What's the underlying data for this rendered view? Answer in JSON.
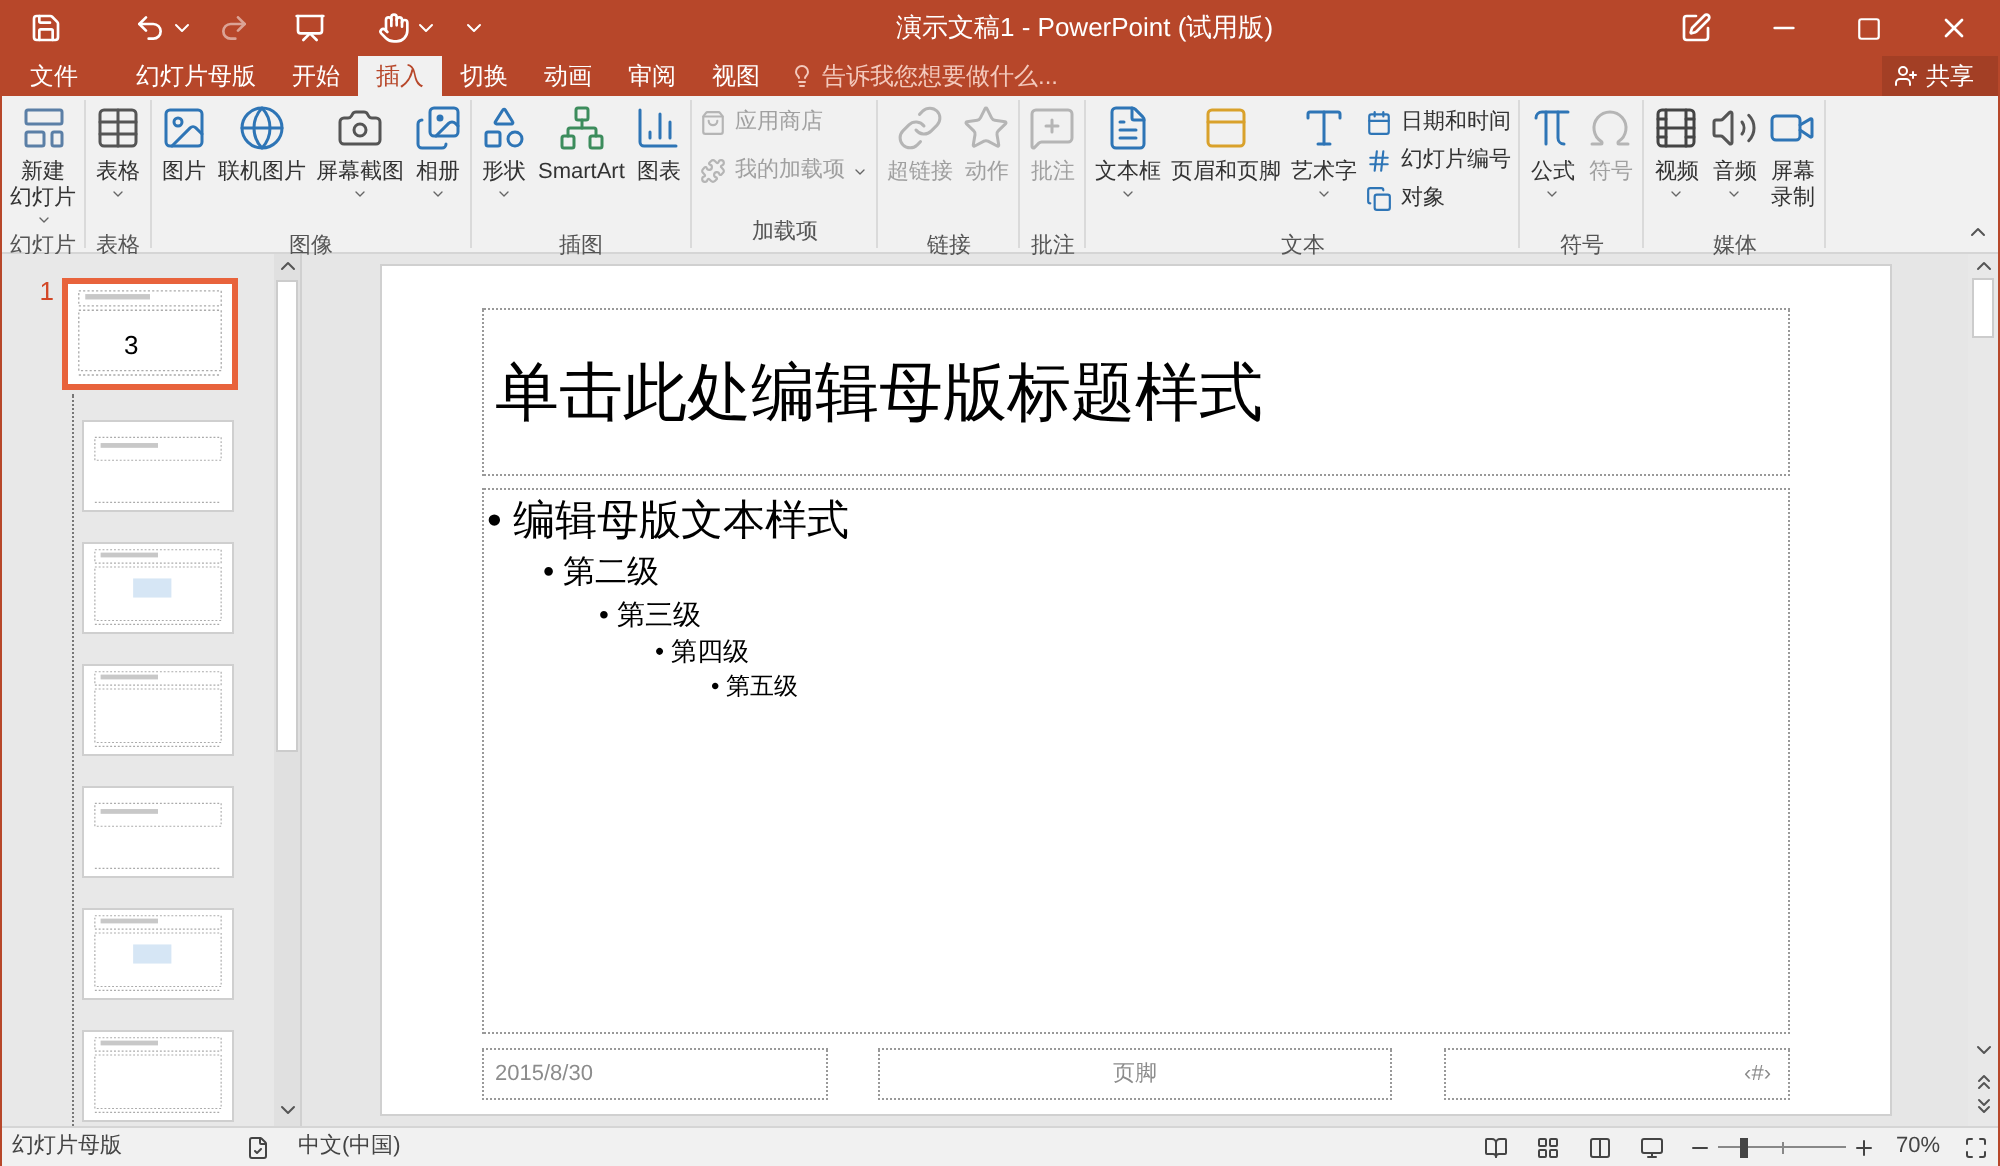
{
  "window": {
    "title": "演示文稿1 - PowerPoint (试用版)"
  },
  "tabs": [
    {
      "label": "文件",
      "selected": false
    },
    {
      "label": "幻灯片母版",
      "selected": false
    },
    {
      "label": "开始",
      "selected": false
    },
    {
      "label": "插入",
      "selected": true
    },
    {
      "label": "切换",
      "selected": false
    },
    {
      "label": "动画",
      "selected": false
    },
    {
      "label": "审阅",
      "selected": false
    },
    {
      "label": "视图",
      "selected": false
    }
  ],
  "tell_me": {
    "placeholder": "告诉我您想要做什么..."
  },
  "share_button": "共享",
  "ribbon_groups": [
    {
      "name": "幻灯片",
      "items": [
        {
          "kind": "large",
          "label": [
            "新建",
            "幻灯片"
          ],
          "dropdown": true,
          "disabled": false
        }
      ]
    },
    {
      "name": "表格",
      "items": [
        {
          "kind": "large",
          "label": "表格",
          "dropdown": true,
          "disabled": false
        }
      ]
    },
    {
      "name": "图像",
      "items": [
        {
          "kind": "large",
          "label": "图片",
          "dropdown": false,
          "disabled": false
        },
        {
          "kind": "large",
          "label": "联机图片",
          "dropdown": false,
          "disabled": false
        },
        {
          "kind": "large",
          "label": "屏幕截图",
          "dropdown": true,
          "disabled": false
        },
        {
          "kind": "large",
          "label": "相册",
          "dropdown": true,
          "disabled": false
        }
      ]
    },
    {
      "name": "插图",
      "items": [
        {
          "kind": "large",
          "label": "形状",
          "dropdown": true,
          "disabled": false
        },
        {
          "kind": "large",
          "label": "SmartArt",
          "dropdown": false,
          "disabled": false
        },
        {
          "kind": "large",
          "label": "图表",
          "dropdown": false,
          "disabled": false
        }
      ]
    },
    {
      "name": "加载项",
      "items": [
        {
          "kind": "small",
          "label": "应用商店",
          "dropdown": false,
          "disabled": true
        },
        {
          "kind": "small",
          "label": "我的加载项",
          "dropdown": true,
          "disabled": true
        }
      ]
    },
    {
      "name": "链接",
      "items": [
        {
          "kind": "large",
          "label": "超链接",
          "dropdown": false,
          "disabled": true
        },
        {
          "kind": "large",
          "label": "动作",
          "dropdown": false,
          "disabled": true
        }
      ]
    },
    {
      "name": "批注",
      "items": [
        {
          "kind": "large",
          "label": "批注",
          "dropdown": false,
          "disabled": true
        }
      ]
    },
    {
      "name": "文本",
      "items": [
        {
          "kind": "large",
          "label": "文本框",
          "dropdown": true,
          "disabled": false
        },
        {
          "kind": "large",
          "label": "页眉和页脚",
          "dropdown": false,
          "disabled": false
        },
        {
          "kind": "large",
          "label": "艺术字",
          "dropdown": true,
          "disabled": false
        },
        {
          "kind": "small",
          "label": "日期和时间",
          "dropdown": false,
          "disabled": false
        },
        {
          "kind": "small",
          "label": "幻灯片编号",
          "dropdown": false,
          "disabled": false
        },
        {
          "kind": "small",
          "label": "对象",
          "dropdown": false,
          "disabled": false
        }
      ]
    },
    {
      "name": "符号",
      "items": [
        {
          "kind": "large",
          "label": "公式",
          "dropdown": true,
          "disabled": false
        },
        {
          "kind": "large",
          "label": "符号",
          "dropdown": false,
          "disabled": true
        }
      ]
    },
    {
      "name": "媒体",
      "items": [
        {
          "kind": "large",
          "label": "视频",
          "dropdown": true,
          "disabled": false
        },
        {
          "kind": "large",
          "label": "音频",
          "dropdown": true,
          "disabled": false
        },
        {
          "kind": "large",
          "label": [
            "屏幕",
            "录制"
          ],
          "dropdown": false,
          "disabled": false
        }
      ]
    }
  ],
  "thumbnails": [
    {
      "index": "1",
      "selected": true,
      "text": "3"
    },
    {
      "selected": false
    },
    {
      "selected": false
    },
    {
      "selected": false
    },
    {
      "selected": false
    },
    {
      "selected": false
    },
    {
      "selected": false
    }
  ],
  "slide": {
    "title": "单击此处编辑母版标题样式",
    "bullets": [
      {
        "bullet": "•",
        "text": "编辑母版文本样式",
        "children": [
          {
            "bullet": "•",
            "text": "第二级",
            "children": [
              {
                "bullet": "•",
                "text": "第三级",
                "children": [
                  {
                    "bullet": "•",
                    "text": "第四级",
                    "children": [
                      {
                        "bullet": "•",
                        "text": "第五级"
                      }
                    ]
                  }
                ]
              }
            ]
          }
        ]
      }
    ],
    "footer": {
      "date": "2015/8/30",
      "footer": "页脚",
      "number": "‹#›"
    }
  },
  "status_bar": {
    "view": "幻灯片母版",
    "language": "中文(中国)",
    "zoom": {
      "level": 0.2,
      "reading": "70%"
    }
  }
}
